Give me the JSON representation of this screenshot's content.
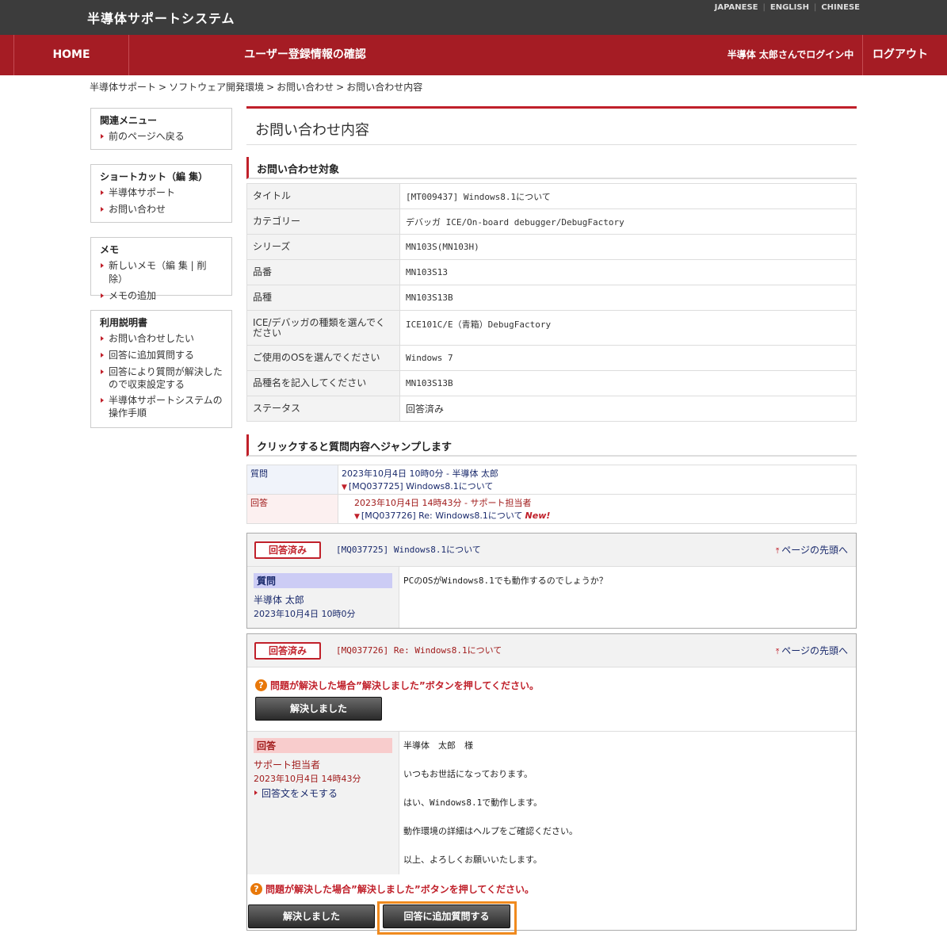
{
  "header": {
    "site_title": "半導体サポートシステム",
    "langs": [
      "JAPANESE",
      "ENGLISH",
      "CHINESE"
    ]
  },
  "nav": {
    "home": "HOME",
    "confirm": "ユーザー登録情報の確認",
    "login_status": "半導体 太郎さんでログイン中",
    "logout": "ログアウト"
  },
  "breadcrumb": [
    "半導体サポート",
    "ソフトウェア開発環境",
    "お問い合わせ",
    "お問い合わせ内容"
  ],
  "sidebar": {
    "related": {
      "title": "関連メニュー",
      "items": [
        "前のページへ戻る"
      ]
    },
    "shortcut": {
      "title": "ショートカット（編 集）",
      "items": [
        "半導体サポート",
        "お問い合わせ"
      ]
    },
    "memo": {
      "title": "メモ",
      "items": [
        "新しいメモ（編 集 | 削 除）",
        "メモの追加"
      ]
    },
    "manual": {
      "title": "利用説明書",
      "items": [
        "お問い合わせしたい",
        "回答に追加質問する",
        "回答により質問が解決したので収束設定する",
        "半導体サポートシステムの操作手順"
      ]
    }
  },
  "main": {
    "page_title": "お問い合わせ内容",
    "target_heading": "お問い合わせ対象",
    "info": [
      {
        "k": "タイトル",
        "v": "[MT009437] Windows8.1について"
      },
      {
        "k": "カテゴリー",
        "v": "デバッガ ICE/On-board debugger/DebugFactory"
      },
      {
        "k": "シリーズ",
        "v": "MN103S(MN103H)"
      },
      {
        "k": "品番",
        "v": "MN103S13"
      },
      {
        "k": "品種",
        "v": "MN103S13B"
      },
      {
        "k": "ICE/デバッガの種類を選んでください",
        "v": "ICE101C/E（青箱）DebugFactory"
      },
      {
        "k": "ご使用のOSを選んでください",
        "v": "Windows 7"
      },
      {
        "k": "品種名を記入してください",
        "v": "MN103S13B"
      },
      {
        "k": "ステータス",
        "v": "回答済み"
      }
    ],
    "jump_heading": "クリックすると質問内容へジャンプします",
    "jump": {
      "q_label": "質問",
      "q_meta": "2023年10月4日 10時0分 - 半導体 太郎",
      "q_link": "[MQ037725] Windows8.1について",
      "a_label": "回答",
      "a_meta": "2023年10月4日 14時43分 - サポート担当者",
      "a_link": "[MQ037726] Re: Windows8.1について",
      "a_new": "New!"
    },
    "question": {
      "stamp": "回答済み",
      "subject": "[MQ037725] Windows8.1について",
      "top_link": "ページの先頭へ",
      "tag": "質問",
      "author": "半導体 太郎",
      "date": "2023年10月4日 10時0分",
      "body": "PCのOSがWindows8.1でも動作するのでしょうか？"
    },
    "answer": {
      "stamp": "回答済み",
      "subject": "[MQ037726] Re: Windows8.1について",
      "top_link": "ページの先頭へ",
      "warn": "問題が解決した場合”解決しました”ボタンを押してください。",
      "resolve_btn": "解決しました",
      "tag": "回答",
      "author": "サポート担当者",
      "date": "2023年10月4日 14時43分",
      "memo_link": "回答文をメモする",
      "body": [
        "半導体　太郎　様",
        "いつもお世話になっております。",
        "はい、Windows8.1で動作します。",
        "動作環境の詳細はヘルプをご確認ください。",
        "以上、よろしくお願いいたします。"
      ]
    },
    "bottom": {
      "warn": "問題が解決した場合”解決しました”ボタンを押してください。",
      "resolve_btn": "解決しました",
      "followup_btn": "回答に追加質問する"
    }
  },
  "colors": {
    "brand_red": "#a51c24",
    "top_bar": "#3c3c3c",
    "highlight_orange": "#f08a1e"
  }
}
